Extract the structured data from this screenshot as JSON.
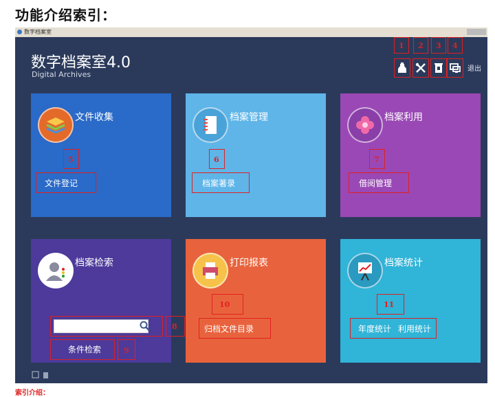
{
  "heading": "功能介绍索引：",
  "window": {
    "titlebar_text": "数字档案室",
    "app_title": "数字档案室4.0",
    "app_subtitle": "Digital Archives",
    "logout": "退出"
  },
  "toolbar": {
    "numbers": [
      "1",
      "2",
      "3",
      "4"
    ],
    "icons": [
      "ink-bottle-icon",
      "tools-icon",
      "trash-icon",
      "monitor-icon"
    ]
  },
  "tiles": [
    {
      "title": "文件收集",
      "action": "文件登记",
      "number": "5",
      "color": "#2a6ac8",
      "icon": "layers-icon"
    },
    {
      "title": "档案管理",
      "action": "档案著录",
      "number": "6",
      "color": "#5fb5e8",
      "icon": "notebook-icon"
    },
    {
      "title": "档案利用",
      "action": "借阅管理",
      "number": "7",
      "color": "#9a48b5",
      "icon": "flower-icon"
    },
    {
      "title": "档案检索",
      "action": "条件检索",
      "number": "9",
      "search_number": "8",
      "color": "#4d3a9a",
      "icon": "user-icon"
    },
    {
      "title": "打印报表",
      "action": "归档文件目录",
      "number": "10",
      "color": "#e8633d",
      "icon": "printer-icon"
    },
    {
      "title": "档案统计",
      "actions": [
        "年度统计",
        "利用统计"
      ],
      "number": "11",
      "color": "#30b4d8",
      "icon": "chart-board-icon"
    }
  ],
  "bottom_note": "索引介绍："
}
